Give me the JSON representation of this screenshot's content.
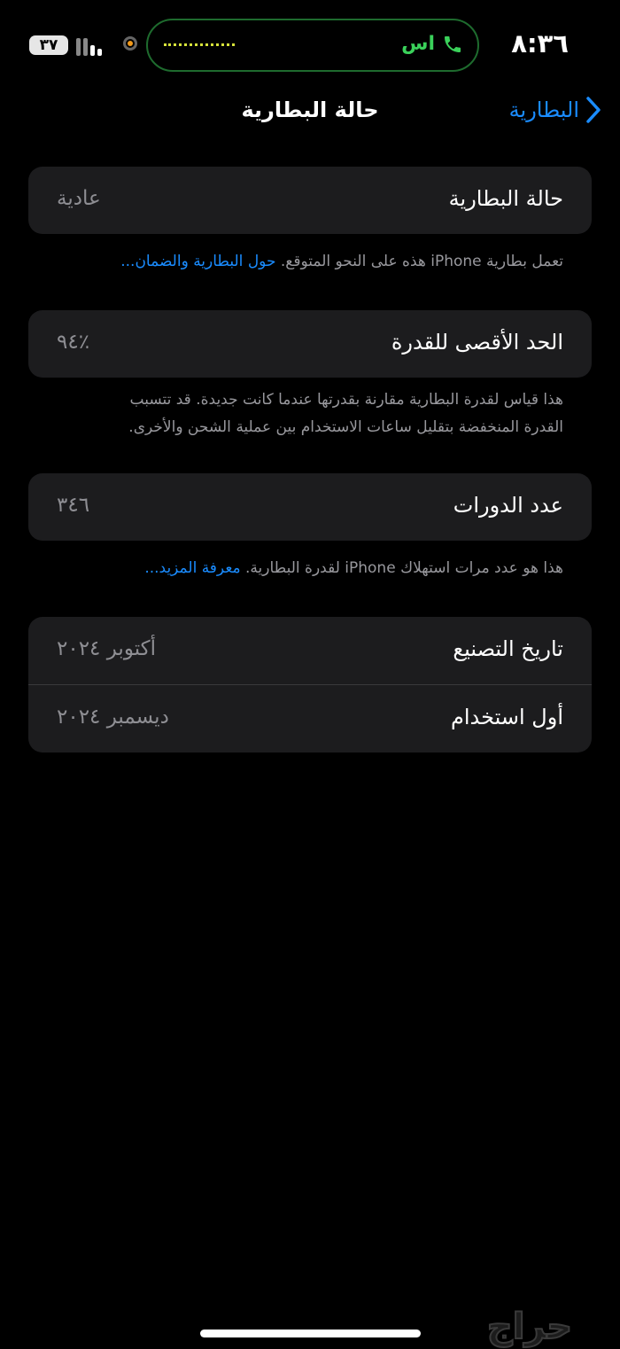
{
  "status_bar": {
    "time": "٨:٣٦",
    "call_label": "اس",
    "battery_level": "٣٧",
    "colors": {
      "call": "#3ad15a",
      "recording": "#f39a1a"
    }
  },
  "nav": {
    "back_label": "البطارية",
    "title": "حالة البطارية"
  },
  "battery_condition": {
    "label": "حالة البطارية",
    "value": "عادية",
    "footnote": "تعمل بطارية iPhone هذه على النحو المتوقع.",
    "footnote_link": "حول البطارية والضمان..."
  },
  "max_capacity": {
    "label": "الحد الأقصى للقدرة",
    "value": "٪٩٤",
    "footnote_line1": "هذا قياس لقدرة البطارية مقارنة بقدرتها عندما كانت جديدة. قد تتسبب",
    "footnote_line2": "القدرة المنخفضة بتقليل ساعات الاستخدام بين عملية الشحن والأخرى."
  },
  "cycle_count": {
    "label": "عدد الدورات",
    "value": "٣٤٦",
    "footnote": "هذا هو عدد مرات استهلاك iPhone لقدرة البطارية.",
    "footnote_link": "معرفة المزيد..."
  },
  "dates": {
    "manufacture_label": "تاريخ التصنيع",
    "manufacture_value": "أكتوبر ٢٠٢٤",
    "first_use_label": "أول استخدام",
    "first_use_value": "ديسمبر ٢٠٢٤"
  },
  "watermark": "حراج",
  "accent_color": "#1a8cff"
}
